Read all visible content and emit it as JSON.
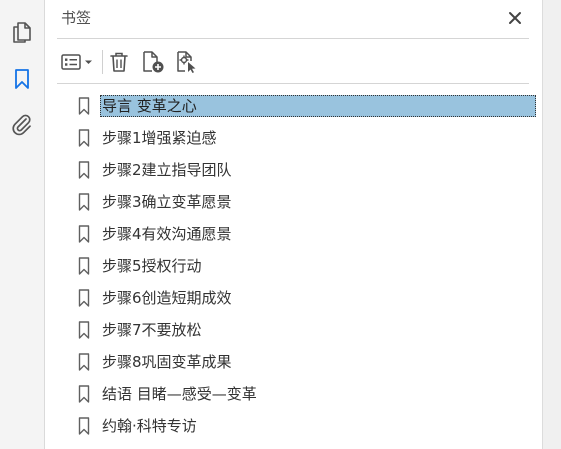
{
  "panel": {
    "title": "书签"
  },
  "left_rail": {
    "items": [
      {
        "name": "pages-thumbnails",
        "icon": "pages-icon"
      },
      {
        "name": "bookmarks",
        "icon": "bookmark-icon",
        "active": true
      },
      {
        "name": "attachments",
        "icon": "paperclip-icon"
      }
    ]
  },
  "toolbar": {
    "tools": [
      {
        "name": "options-menu",
        "icon": "options-list-icon"
      },
      {
        "name": "delete-bookmark",
        "icon": "trash-icon"
      },
      {
        "name": "new-bookmark",
        "icon": "add-bookmark-icon"
      },
      {
        "name": "new-bookmark-from-structure",
        "icon": "bookmark-cursor-icon"
      }
    ]
  },
  "bookmarks": {
    "items": [
      {
        "label": "导言  变革之心",
        "selected": true
      },
      {
        "label": "步骤1增强紧迫感"
      },
      {
        "label": "步骤2建立指导团队"
      },
      {
        "label": "步骤3确立变革愿景"
      },
      {
        "label": "步骤4有效沟通愿景"
      },
      {
        "label": "步骤5授权行动"
      },
      {
        "label": "步骤6创造短期成效"
      },
      {
        "label": "步骤7不要放松"
      },
      {
        "label": "步骤8巩固变革成果"
      },
      {
        "label": "结语  目睹—感受—变革"
      },
      {
        "label": "约翰·科特专访"
      }
    ]
  },
  "colors": {
    "accent": "#1473e6",
    "selection": "#99c3de",
    "icon": "#505050"
  }
}
